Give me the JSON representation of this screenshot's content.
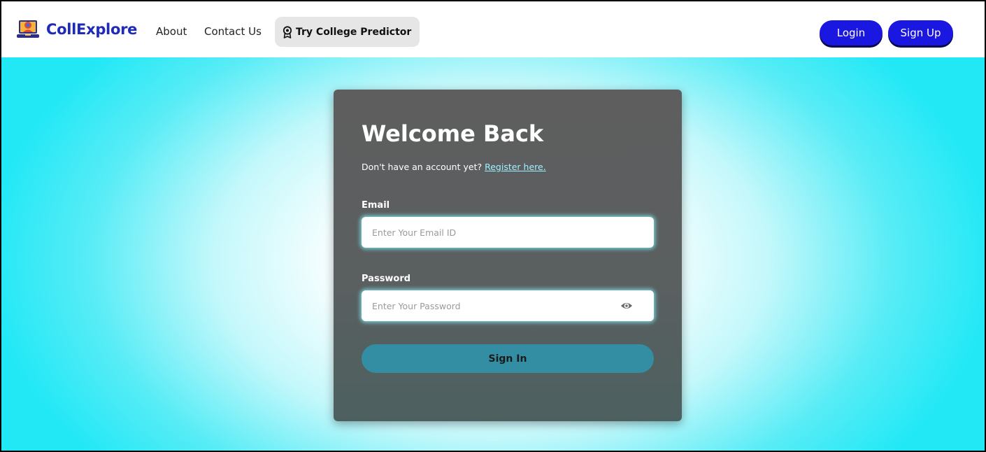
{
  "navbar": {
    "brand": "CollExplore",
    "links": [
      "About",
      "Contact Us"
    ],
    "predictor_label": "Try College Predictor",
    "login_label": "Login",
    "signup_label": "Sign Up"
  },
  "login_card": {
    "title": "Welcome Back",
    "prompt_text": "Don't have an account yet?",
    "register_link": "Register here.",
    "email_label": "Email",
    "email_placeholder": "Enter Your Email ID",
    "password_label": "Password",
    "password_placeholder": "Enter Your Password",
    "signin_label": "Sign In"
  },
  "colors": {
    "brand": "#1f2bb8",
    "nav_button": "#1a17e0",
    "card": "#5e5e5e",
    "signin_button": "#338ea3",
    "hero_edge": "#22e8f6"
  },
  "icons": {
    "logo": "laptop-graduation-icon",
    "predictor": "award-ribbon-icon",
    "password_toggle": "eye-icon"
  }
}
